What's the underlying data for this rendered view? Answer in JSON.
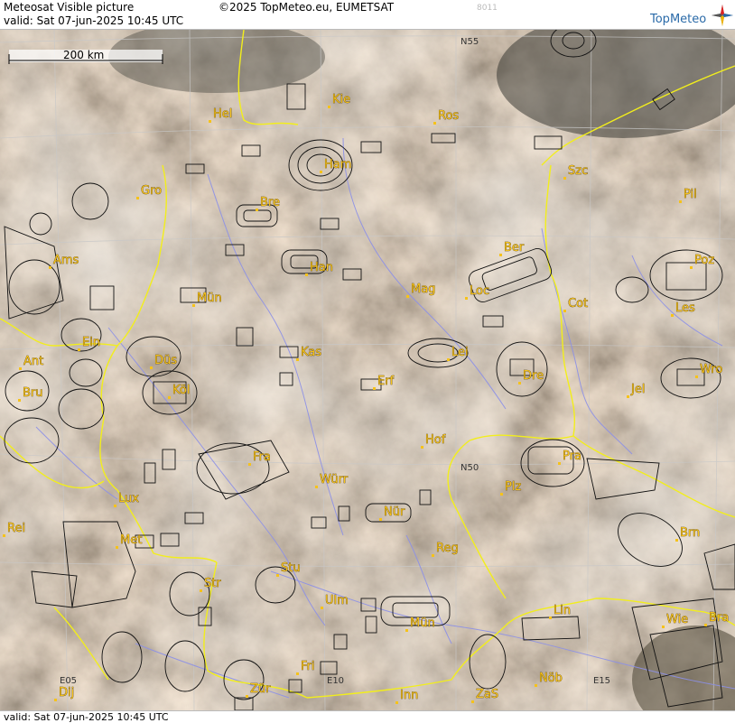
{
  "header": {
    "title": "Meteosat Visible picture",
    "valid": "valid:  Sat  07-jun-2025  10:45 UTC",
    "copyright": "©2025 TopMeteo.eu, EUMETSAT",
    "code": "8011",
    "brand": "TopMeteo",
    "brand_icon": "compass-star-icon"
  },
  "footer": {
    "valid": "valid:  Sat  07-jun-2025  10:45 UTC"
  },
  "map": {
    "scale_label": "200 km",
    "grid_labels": [
      "N55",
      "N50",
      "E05",
      "E10",
      "E15"
    ],
    "cities": [
      "Hel",
      "Kie",
      "Ros",
      "Ham",
      "Szc",
      "Gro",
      "Bre",
      "Pil",
      "Ber",
      "Ams",
      "Han",
      "Poz",
      "Mün",
      "Mag",
      "Loc",
      "Cot",
      "Les",
      "Ein",
      "Lei",
      "Ant",
      "Düs",
      "Kas",
      "Wro",
      "Bru",
      "Köl",
      "Erf",
      "Dre",
      "Jel",
      "Hof",
      "Fra",
      "Pra",
      "Würr",
      "Plz",
      "Lux",
      "Nür",
      "Rei",
      "Met",
      "Reg",
      "Brn",
      "Str",
      "Stu",
      "Ulm",
      "Lin",
      "Mün",
      "Wie",
      "Bra",
      "Fri",
      "Zür",
      "Dij",
      "Inn",
      "ZaS",
      "Nöb"
    ],
    "colors": {
      "border": "#f2ee1c",
      "river": "#8c90e8",
      "grid": "#c8c8c8",
      "city": "#f5c21b",
      "airspace": "#111111"
    }
  }
}
